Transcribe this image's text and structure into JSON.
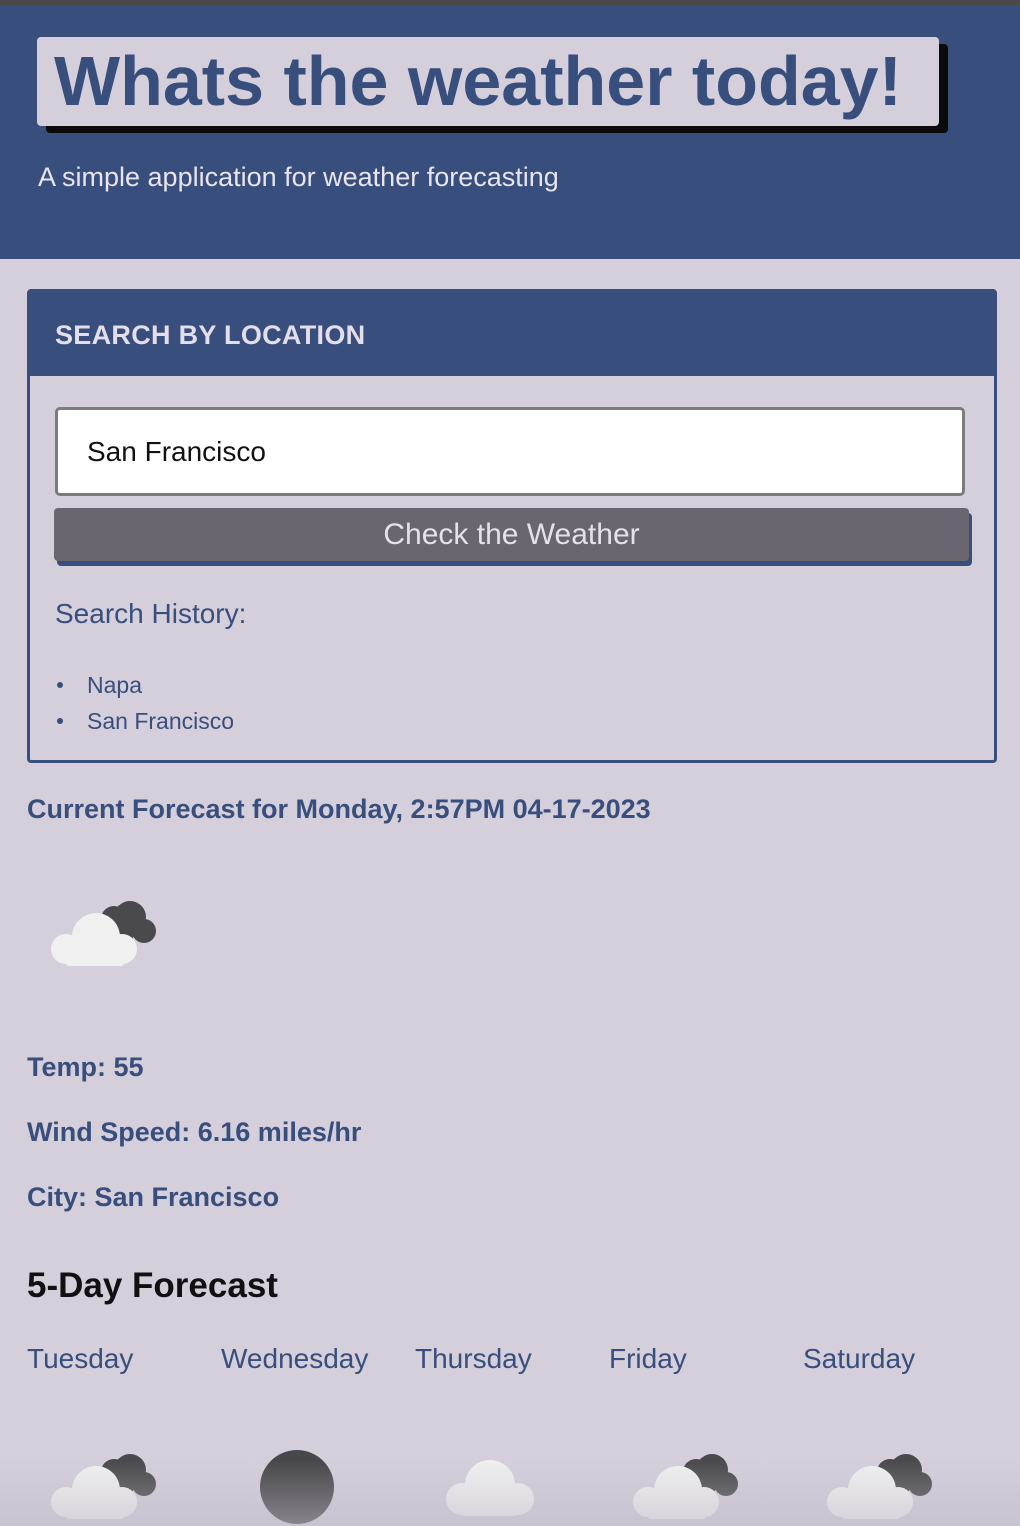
{
  "header": {
    "title": "Whats the weather today!",
    "subtitle": "A simple application for weather forecasting"
  },
  "search": {
    "heading": "SEARCH BY LOCATION",
    "input_value": "San Francisco",
    "button_label": "Check the Weather",
    "history_label": "Search History:",
    "history": [
      "Napa",
      "San Francisco"
    ]
  },
  "current": {
    "title": "Current Forecast for Monday, 2:57PM 04-17-2023",
    "icon": "broken-clouds-icon",
    "temp": "Temp: 55",
    "wind": "Wind Speed: 6.16 miles/hr",
    "city": "City: San Francisco"
  },
  "forecast": {
    "title": "5-Day Forecast",
    "days": [
      {
        "day": "Tuesday",
        "icon": "broken-clouds-icon"
      },
      {
        "day": "Wednesday",
        "icon": "dark-circle-icon"
      },
      {
        "day": "Thursday",
        "icon": "cloud-icon"
      },
      {
        "day": "Friday",
        "icon": "broken-clouds-icon"
      },
      {
        "day": "Saturday",
        "icon": "broken-clouds-icon"
      }
    ]
  },
  "colors": {
    "primary": "#384e7c",
    "background": "#d5cfdc",
    "button": "#6b6570"
  }
}
